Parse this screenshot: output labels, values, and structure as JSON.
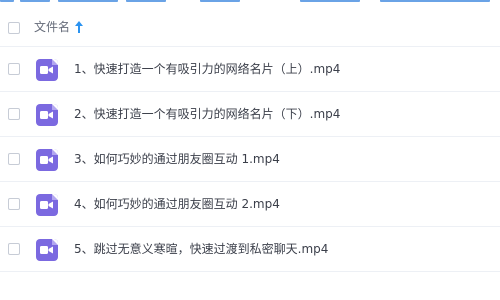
{
  "header": {
    "column_label": "文件名",
    "sort_icon": "arrow-up-icon",
    "sort_color": "#2b93f0"
  },
  "file_icon": {
    "name": "video-file-icon",
    "color": "#7b69e0"
  },
  "files": [
    {
      "name": "1、快速打造一个有吸引力的网络名片（上）.mp4"
    },
    {
      "name": "2、快速打造一个有吸引力的网络名片（下）.mp4"
    },
    {
      "name": "3、如何巧妙的通过朋友圈互动 1.mp4"
    },
    {
      "name": "4、如何巧妙的通过朋友圈互动 2.mp4"
    },
    {
      "name": "5、跳过无意义寒暄，快速过渡到私密聊天.mp4"
    }
  ]
}
